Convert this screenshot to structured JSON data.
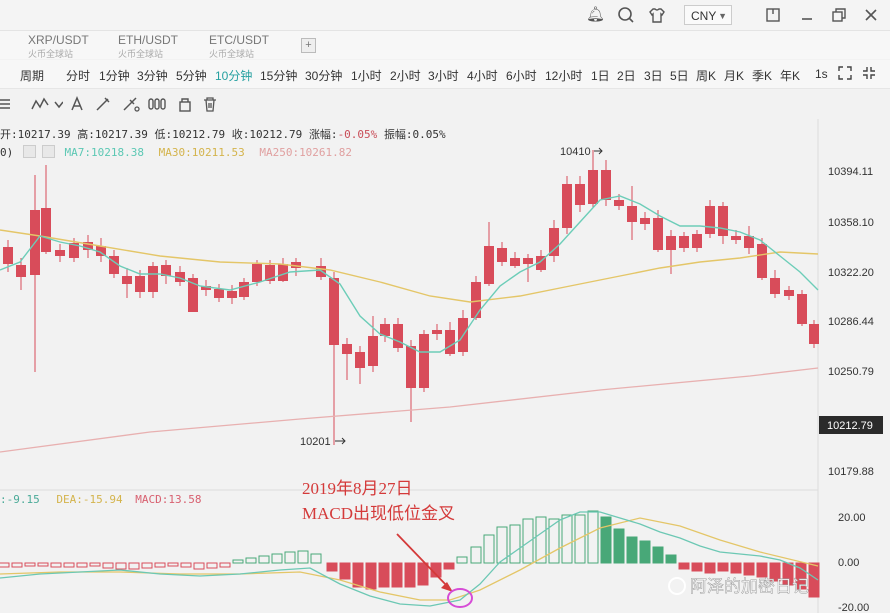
{
  "topbar": {
    "currency": "CNY",
    "icons": [
      "bell-icon",
      "search-icon",
      "shirt-icon",
      "window-icon",
      "minimize-icon",
      "restore-icon",
      "close-icon"
    ]
  },
  "pairs": [
    {
      "name": "XRP/USDT",
      "sub": "火币全球站"
    },
    {
      "name": "ETH/USDT",
      "sub": "火币全球站"
    },
    {
      "name": "ETC/USDT",
      "sub": "火币全球站"
    }
  ],
  "add_pair_label": "+",
  "intervals": {
    "label": "周期",
    "items": [
      "分时",
      "1分钟",
      "3分钟",
      "5分钟",
      "10分钟",
      "15分钟",
      "30分钟",
      "1小时",
      "2小时",
      "3小时",
      "4小时",
      "6小时",
      "12小时",
      "1日",
      "2日",
      "3日",
      "5日",
      "周K",
      "月K",
      "季K",
      "年K"
    ],
    "active": "10分钟",
    "seconds": "1s"
  },
  "ohlc": {
    "open": "开:10217.39",
    "high": "高:10217.39",
    "low": "低:10212.79",
    "close": "收:10212.79",
    "change_label": "涨幅:",
    "change_value": "-0.05%",
    "amp": "振幅:0.05%"
  },
  "ma": {
    "prefix": "0)",
    "ma7": "MA7:10218.38",
    "ma30": "MA30:10211.53",
    "ma250": "MA250:10261.82",
    "colors": {
      "ma7": "#5cc8b4",
      "ma30": "#e4c668",
      "ma250": "#e8a8a8"
    }
  },
  "macd_legend": {
    "dif": ":-9.15",
    "dea": "DEA:-15.94",
    "macd": "MACD:13.58"
  },
  "price_axis": {
    "ticks": [
      "10394.11",
      "10358.10",
      "10322.20",
      "10286.44",
      "10250.79",
      "10179.88"
    ],
    "current": "10212.79"
  },
  "macd_axis": {
    "ticks": [
      "20.00",
      "0.00",
      "-20.00"
    ]
  },
  "annotations": {
    "high_label": "10410",
    "low_label": "10201",
    "date": "2019年8月27日",
    "note": "MACD出现低位金叉"
  },
  "watermark": "阿泽的加密日记",
  "colors": {
    "up": "#48a878",
    "down": "#d84c5a",
    "accent": "#25a0a0",
    "annotation": "#d43a3a",
    "circle": "#d64cd6"
  }
}
